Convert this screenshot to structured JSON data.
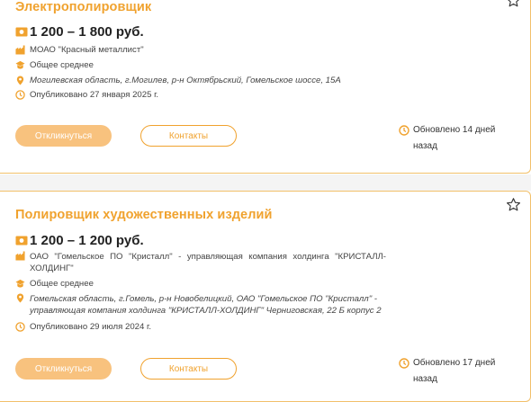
{
  "vacancies": [
    {
      "title": "Электрополировщик",
      "salary": "1 200 – 1 800 руб.",
      "company": "МОАО \"Красный металлист\"",
      "education": "Общее среднее",
      "address": "Могилевская область, г.Могилев, р-н Октябрьский, Гомельское шоссе, 15А",
      "published": "Опубликовано 27 января 2025 г.",
      "apply_label": "Откликнуться",
      "contacts_label": "Контакты",
      "updated": "Обновлено 14 дней назад"
    },
    {
      "title": "Полировщик художественных изделий",
      "salary": "1 200 – 1 200 руб.",
      "company": "ОАО \"Гомельское ПО \"Кристалл\" - управляющая компания холдинга \"КРИСТАЛЛ-ХОЛДИНГ\"",
      "education": "Общее среднее",
      "address": "Гомельская область, г.Гомель, р-н Новобелицкий, ОАО \"Гомельское ПО \"Кристалл\" - управляющая компания холдинга \"КРИСТАЛЛ-ХОЛДИНГ\" Черниговская, 22 Б корпус 2",
      "published": "Опубликовано 29 июля 2024 г.",
      "apply_label": "Откликнуться",
      "contacts_label": "Контакты",
      "updated": "Обновлено 17 дней назад"
    }
  ],
  "colors": {
    "accent": "#f0a22e",
    "button_fill": "#f8c27e",
    "card_border": "#f2c06a"
  },
  "icons": [
    "star-icon",
    "money-icon",
    "factory-icon",
    "graduation-cap-icon",
    "location-pin-icon",
    "clock-icon"
  ]
}
